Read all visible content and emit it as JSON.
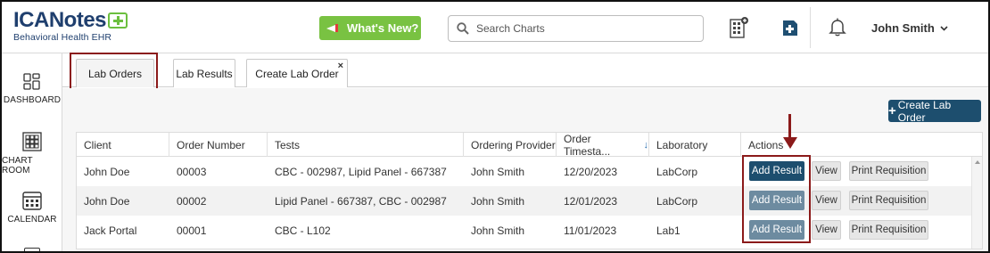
{
  "brand": {
    "name": "ICANotes",
    "tagline": "Behavioral Health EHR",
    "color": "#1f3f6e",
    "accent": "#6cbf3f"
  },
  "header": {
    "whats_new_label": "What's New?",
    "search_placeholder": "Search Charts",
    "user_name": "John Smith",
    "icons": [
      "megaphone-icon",
      "search-icon",
      "charts-icon",
      "add-chart-icon",
      "bell-icon",
      "chevron-down-icon"
    ]
  },
  "sidebar": {
    "items": [
      {
        "label": "DASHBOARD",
        "icon": "dashboard-icon"
      },
      {
        "label": "CHART ROOM",
        "icon": "chart-room-icon"
      },
      {
        "label": "CALENDAR",
        "icon": "calendar-icon"
      }
    ]
  },
  "tabs": [
    {
      "label": "Lab Orders",
      "active": true
    },
    {
      "label": "Lab Results",
      "active": false
    },
    {
      "label": "Create Lab Order",
      "active": false,
      "closable": true
    }
  ],
  "tab_close_glyph": "×",
  "toolbar": {
    "create_button_label": "Create Lab Order",
    "create_button_plus": "+"
  },
  "table": {
    "columns": [
      "Client",
      "Order Number",
      "Tests",
      "Ordering Provider",
      "Order Timesta...",
      "Laboratory",
      "Actions"
    ],
    "sort_indicator": "↓",
    "rows": [
      {
        "client": "John Doe",
        "order_number": "00003",
        "tests": "CBC - 002987, Lipid Panel - 667387",
        "provider": "John Smith",
        "timestamp": "12/20/2023",
        "laboratory": "LabCorp"
      },
      {
        "client": "John Doe",
        "order_number": "00002",
        "tests": "Lipid Panel - 667387, CBC - 002987",
        "provider": "John Smith",
        "timestamp": "12/01/2023",
        "laboratory": "LabCorp"
      },
      {
        "client": "Jack Portal",
        "order_number": "00001",
        "tests": "CBC - L102",
        "provider": "John Smith",
        "timestamp": "11/01/2023",
        "laboratory": "Lab1"
      }
    ],
    "actions": {
      "add_result": "Add Result",
      "view": "View",
      "print_requisition": "Print Requisition"
    }
  },
  "colors": {
    "primary_button": "#1d4e6e",
    "whats_new": "#79c242",
    "highlight": "#8b1a1a"
  }
}
